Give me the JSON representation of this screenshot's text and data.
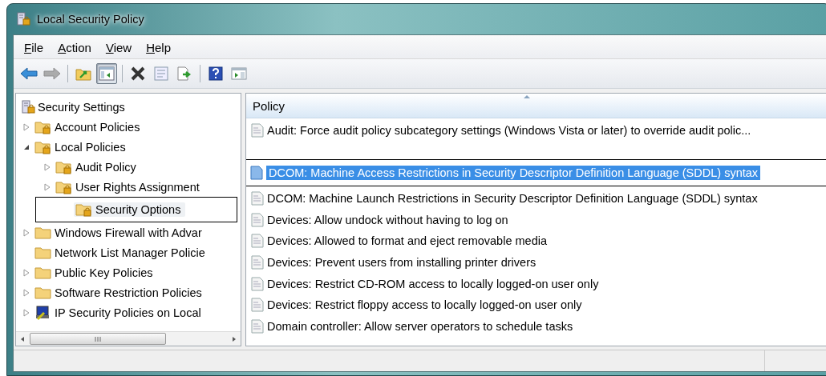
{
  "window": {
    "title": "Local Security Policy"
  },
  "menu": [
    {
      "label": "File"
    },
    {
      "label": "Action"
    },
    {
      "label": "View"
    },
    {
      "label": "Help"
    }
  ],
  "toolbar": [
    {
      "kind": "back",
      "disabled": false,
      "pressed": false
    },
    {
      "kind": "forward",
      "disabled": true,
      "pressed": false
    },
    {
      "kind": "separator"
    },
    {
      "kind": "up",
      "disabled": false,
      "pressed": false
    },
    {
      "kind": "tree",
      "disabled": false,
      "pressed": true
    },
    {
      "kind": "separator"
    },
    {
      "kind": "delete",
      "disabled": false,
      "pressed": false
    },
    {
      "kind": "properties",
      "disabled": false,
      "pressed": false
    },
    {
      "kind": "export",
      "disabled": false,
      "pressed": false
    },
    {
      "kind": "separator"
    },
    {
      "kind": "help",
      "disabled": false,
      "pressed": false
    },
    {
      "kind": "actionpane",
      "disabled": false,
      "pressed": false
    }
  ],
  "tree": [
    {
      "label": "Security Settings",
      "kind": "root",
      "selected": false,
      "children": [
        {
          "label": "Account Policies",
          "kind": "lockfolder",
          "expanded": false,
          "selected": false
        },
        {
          "label": "Local Policies",
          "kind": "lockfolder",
          "expanded": true,
          "selected": false,
          "children": [
            {
              "label": "Audit Policy",
              "kind": "lockfolder",
              "expanded": false,
              "selected": false
            },
            {
              "label": "User Rights Assignment",
              "kind": "lockfolder",
              "expanded": false,
              "selected": false
            },
            {
              "label": "Security Options",
              "kind": "lockfolder",
              "selected": true
            }
          ]
        },
        {
          "label": "Windows Firewall with Advar",
          "kind": "folder",
          "expanded": false,
          "selected": false
        },
        {
          "label": "Network List Manager Policie",
          "kind": "folder",
          "selected": false
        },
        {
          "label": "Public Key Policies",
          "kind": "folder",
          "expanded": false,
          "selected": false
        },
        {
          "label": "Software Restriction Policies",
          "kind": "folder",
          "expanded": false,
          "selected": false
        },
        {
          "label": "IP Security Policies on Local",
          "kind": "ipsec",
          "expanded": false,
          "selected": false
        }
      ]
    }
  ],
  "table": {
    "columns": [
      "Policy"
    ],
    "rows": [
      {
        "policy": "Audit: Force audit policy subcategory settings (Windows Vista or later) to override audit polic...",
        "selected": false
      },
      {
        "policy": "DCOM: Machine Access Restrictions in Security Descriptor Definition Language (SDDL) syntax",
        "selected": true
      },
      {
        "policy": "DCOM: Machine Launch Restrictions in Security Descriptor Definition Language (SDDL) syntax",
        "selected": false
      },
      {
        "policy": "Devices: Allow undock without having to log on",
        "selected": false
      },
      {
        "policy": "Devices: Allowed to format and eject removable media",
        "selected": false
      },
      {
        "policy": "Devices: Prevent users from installing printer drivers",
        "selected": false
      },
      {
        "policy": "Devices: Restrict CD-ROM access to locally logged-on user only",
        "selected": false
      },
      {
        "policy": "Devices: Restrict floppy access to locally logged-on user only",
        "selected": false
      },
      {
        "policy": "Domain controller: Allow server operators to schedule tasks",
        "selected": false
      }
    ]
  }
}
